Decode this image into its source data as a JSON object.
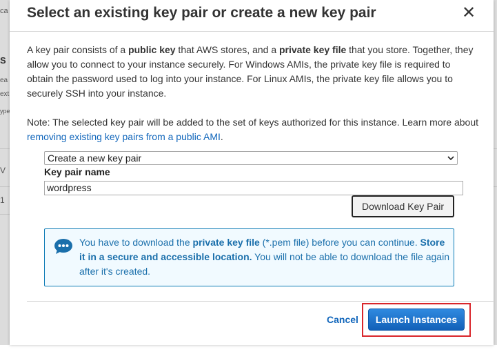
{
  "background": {
    "fragments": [
      "ca",
      "S",
      "ea",
      "ext",
      "ype",
      "V",
      "1"
    ]
  },
  "modal": {
    "title": "Select an existing key pair or create a new key pair",
    "close_glyph": "✕",
    "intro": {
      "t1": "A key pair consists of a ",
      "b1": "public key",
      "t2": " that AWS stores, and a ",
      "b2": "private key file",
      "t3": " that you store. Together, they allow you to connect to your instance securely. For Windows AMIs, the private key file is required to obtain the password used to log into your instance. For Linux AMIs, the private key file allows you to securely SSH into your instance."
    },
    "note": {
      "t1": "Note: The selected key pair will be added to the set of keys authorized for this instance. Learn more about ",
      "link": "removing existing key pairs from a public AMI",
      "t2": "."
    },
    "key_pair_select": {
      "selected": "Create a new key pair"
    },
    "key_pair_name": {
      "label": "Key pair name",
      "value": "wordpress"
    },
    "download_button": "Download Key Pair",
    "info": {
      "icon": "speech-bubble-icon",
      "t1": "You have to download the ",
      "b1": "private key file",
      "t2": " (*.pem file) before you can continue. ",
      "b2": "Store it in a secure and accessible location.",
      "t3": " You will not be able to download the file again after it's created."
    },
    "cancel_label": "Cancel",
    "launch_label": "Launch Instances"
  },
  "colors": {
    "link": "#1166bb",
    "primary_button": "#1a6fc7",
    "info_border": "#0b7ab5",
    "highlight": "#d9262b"
  }
}
